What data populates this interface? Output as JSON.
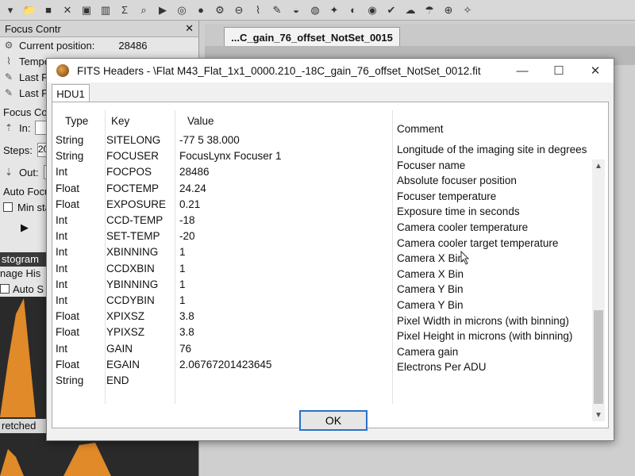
{
  "app": {
    "focus_panel_title": "Focus Contr",
    "focus_rows": [
      {
        "icon": "gear-icon",
        "label": "Current position:",
        "value": "28486"
      },
      {
        "icon": "thermometer-icon",
        "label": "Tempe",
        "value": ""
      },
      {
        "icon": "pencil-icon",
        "label": "Last Fo",
        "value": ""
      },
      {
        "icon": "pencil-icon",
        "label": "Last Fc",
        "value": ""
      }
    ],
    "focus_control_label": "Focus Con",
    "in_label": "In:",
    "steps_label": "Steps:",
    "steps_value": "20",
    "out_label": "Out:",
    "auto_focus_label": "Auto Focu",
    "min_step_label": "Min sta",
    "histogram_title": "stogram",
    "image_hist_label": "nage His",
    "auto_label": "Auto S",
    "stretched_label": "retched",
    "image_tab_label": "...C_gain_76_offset_NotSet_0015"
  },
  "dialog": {
    "title": "FITS Headers - \\Flat M43_Flat_1x1_0000.210_-18C_gain_76_offset_NotSet_0012.fit",
    "tab": "HDU1",
    "columns": {
      "type": "Type",
      "key": "Key",
      "value": "Value",
      "comment": "Comment"
    },
    "rows": [
      {
        "type": "String",
        "key": "SITELONG",
        "value": "-77 5 38.000",
        "comment": "Longitude of the imaging site in degrees"
      },
      {
        "type": "String",
        "key": "FOCUSER",
        "value": "FocusLynx Focuser 1",
        "comment": "Focuser name"
      },
      {
        "type": "Int",
        "key": "FOCPOS",
        "value": "28486",
        "comment": "Absolute focuser position"
      },
      {
        "type": "Float",
        "key": "FOCTEMP",
        "value": "24.24",
        "comment": "Focuser temperature"
      },
      {
        "type": "Float",
        "key": "EXPOSURE",
        "value": "0.21",
        "comment": "Exposure time in seconds"
      },
      {
        "type": "Int",
        "key": "CCD-TEMP",
        "value": "-18",
        "comment": "Camera cooler temperature"
      },
      {
        "type": "Int",
        "key": "SET-TEMP",
        "value": "-20",
        "comment": "Camera cooler target temperature"
      },
      {
        "type": "Int",
        "key": "XBINNING",
        "value": "1",
        "comment": "Camera X Bin"
      },
      {
        "type": "Int",
        "key": "CCDXBIN",
        "value": "1",
        "comment": "Camera X Bin"
      },
      {
        "type": "Int",
        "key": "YBINNING",
        "value": "1",
        "comment": "Camera Y Bin"
      },
      {
        "type": "Int",
        "key": "CCDYBIN",
        "value": "1",
        "comment": "Camera Y Bin"
      },
      {
        "type": "Float",
        "key": "XPIXSZ",
        "value": "3.8",
        "comment": "Pixel Width in microns (with binning)"
      },
      {
        "type": "Float",
        "key": "YPIXSZ",
        "value": "3.8",
        "comment": "Pixel Height in microns (with binning)"
      },
      {
        "type": "Int",
        "key": "GAIN",
        "value": "76",
        "comment": "Camera gain"
      },
      {
        "type": "Float",
        "key": "EGAIN",
        "value": "2.06767201423645",
        "comment": "Electrons Per ADU"
      },
      {
        "type": "String",
        "key": "END",
        "value": "",
        "comment": ""
      }
    ],
    "ok_label": "OK"
  }
}
